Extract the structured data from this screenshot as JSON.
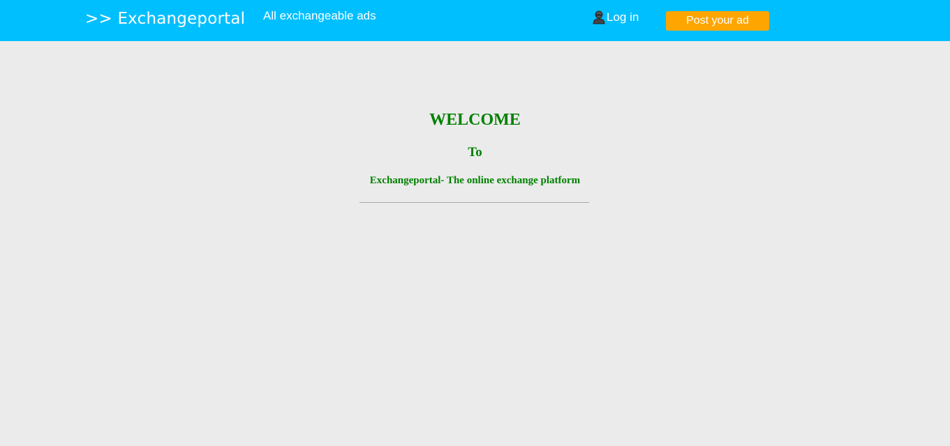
{
  "navbar": {
    "brand": ">> Exchangeportal",
    "all_ads_link": "All exchangeable ads",
    "login_label": "Log in",
    "login_icon": "user-icon",
    "post_ad_label": "Post your ad",
    "colors": {
      "bar": "#00bfff",
      "button": "#ffa500"
    }
  },
  "welcome": {
    "heading": "WELCOME",
    "to": "To",
    "tagline": "Exchangeportal- The online exchange platform",
    "color": "#008000"
  }
}
